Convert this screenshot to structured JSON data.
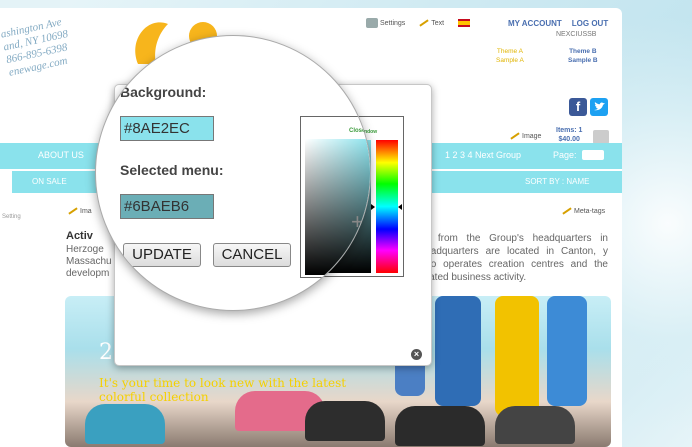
{
  "header": {
    "stamp_lines": [
      "ashington Ave",
      "and, NY 10698",
      "866-895-6398",
      "enewage.com"
    ],
    "settings_label": "Settings",
    "text_label": "Text",
    "my_account": "MY ACCOUNT",
    "log_out": "LOG OUT",
    "username": "NEXCIUSSB",
    "theme_a": [
      "Theme A",
      "Sample A"
    ],
    "theme_b": [
      "Theme B",
      "Sample B"
    ],
    "image_label": "Image",
    "items_label": "Items: 1",
    "cart_total": "$40.00"
  },
  "nav": {
    "about": "ABOUT US",
    "pager": "1 2 3 4",
    "next_group": "Next Group",
    "page_label": "Page:",
    "on_sale": "ON SALE",
    "sort_by": "SORT BY : NAME"
  },
  "content": {
    "sidebar_text": "Setting",
    "image_label": "Ima",
    "metatags": "Meta-tags",
    "article_title": "Activ",
    "article_left": [
      "Herzoge",
      "Massachu",
      "developm"
    ],
    "article_right": "ed from the Group's headquarters in Headquarters are located in Canton, y also operates creation centres and the related business activity.",
    "banner_number": "2",
    "banner_text": "It's your time to look new with the latest colorful collection"
  },
  "dialog": {
    "background_label": "Background:",
    "background_value": "#8AE2EC",
    "selected_menu_label": "Selected menu:",
    "selected_menu_value": "#6BAEB6",
    "update_label": "UPDATE",
    "cancel_label": "CANCEL",
    "picker_title": "Close Window",
    "close_symbol": "×"
  },
  "colors": {
    "background": "#8AE2EC",
    "selected_menu": "#6BAEB6"
  }
}
